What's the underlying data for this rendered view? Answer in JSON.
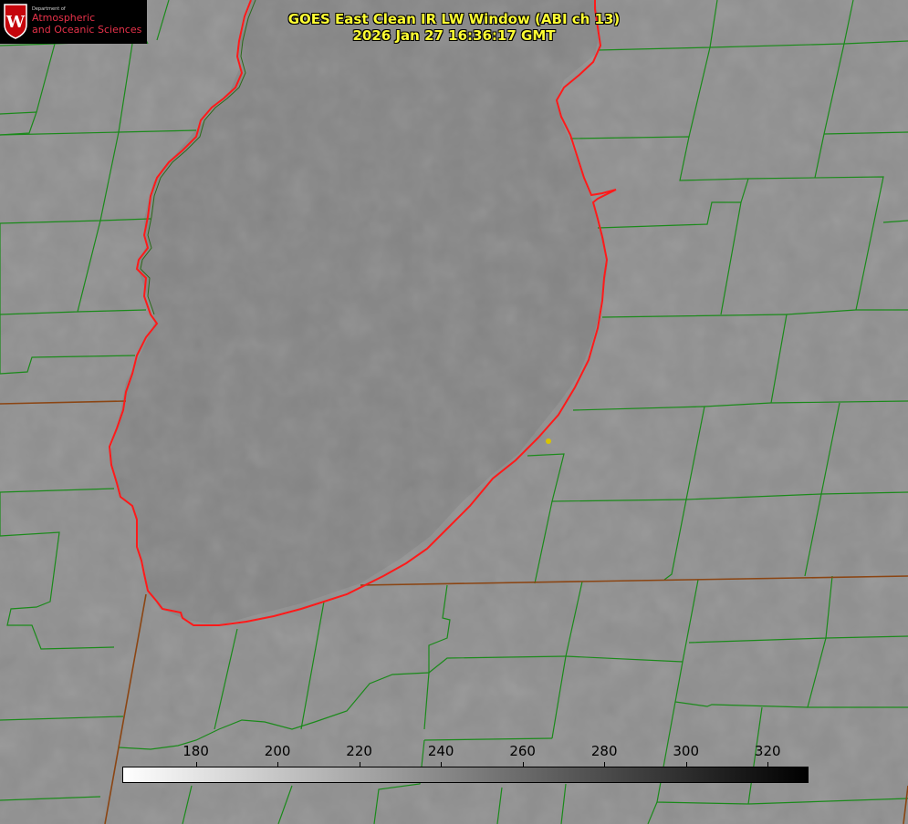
{
  "title": {
    "line1": "GOES East Clean IR LW Window (ABI ch 13)",
    "line2": "2026 Jan 27 16:36:17 GMT"
  },
  "logo": {
    "department": "Department of",
    "line1": "Atmospheric",
    "line2": "and Oceanic Sciences",
    "emblem_letter": "W"
  },
  "colorbar": {
    "ticks": [
      180,
      200,
      220,
      240,
      260,
      280,
      300,
      320
    ],
    "min": 162,
    "max": 330,
    "gradient_from": "#ffffff",
    "gradient_to": "#000000"
  },
  "colors": {
    "county_lines": "#1a8a1a",
    "state_lines": "#8b4513",
    "coastline": "#ff1a1a",
    "title_text": "#ffff33",
    "logo_red": "#e8324a"
  }
}
